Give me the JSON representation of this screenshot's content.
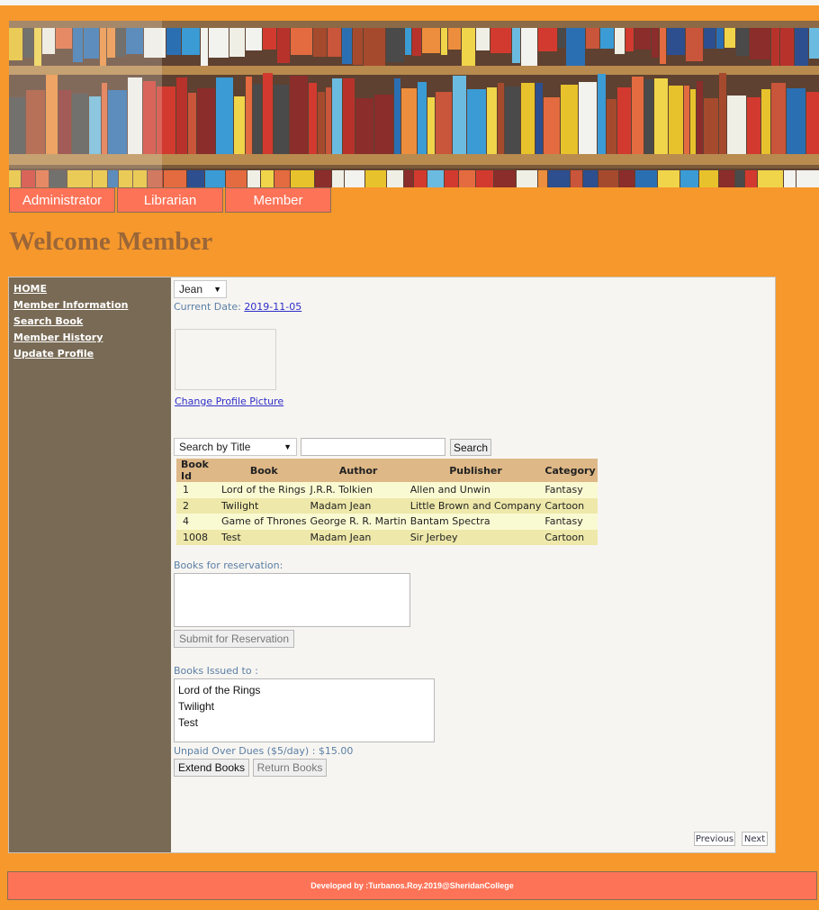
{
  "nav_tabs": [
    "Administrator",
    "Librarian",
    "Member"
  ],
  "welcome_title": "Welcome Member",
  "sidebar": {
    "items": [
      {
        "label": "HOME"
      },
      {
        "label": "Member Information"
      },
      {
        "label": "Search Book",
        "active": true
      },
      {
        "label": "Member History"
      },
      {
        "label": "Update Profile"
      }
    ]
  },
  "member_select": {
    "value": "Jean"
  },
  "current_date": {
    "label": "Current Date:",
    "value": "2019-11-05"
  },
  "profile": {
    "change_picture_label": "Change Profile Picture"
  },
  "search": {
    "mode_value": "Search by Title",
    "query": "",
    "button_label": "Search"
  },
  "books_table": {
    "headers": [
      "Book Id",
      "Book",
      "Author",
      "Publisher",
      "Category"
    ],
    "rows": [
      [
        "1",
        "Lord of the Rings",
        "J.R.R. Tolkien",
        "Allen and Unwin",
        "Fantasy"
      ],
      [
        "2",
        "Twilight",
        "Madam Jean",
        "Little Brown and Company",
        "Cartoon"
      ],
      [
        "4",
        "Game of Thrones",
        "George R. R. Martin",
        "Bantam Spectra",
        "Fantasy"
      ],
      [
        "1008",
        "Test",
        "Madam Jean",
        "Sir Jerbey",
        "Cartoon"
      ]
    ]
  },
  "reservation": {
    "label": "Books for reservation:",
    "items": [],
    "submit_label": "Submit for Reservation"
  },
  "issued": {
    "label": "Books Issued to :",
    "items": [
      "Lord of the Rings",
      "Twilight",
      "Test"
    ]
  },
  "dues": {
    "label": "Unpaid Over Dues ($5/day) :",
    "amount": "$15.00"
  },
  "actions": {
    "extend_label": "Extend Books",
    "return_label": "Return Books"
  },
  "pager": {
    "previous_label": "Previous",
    "next_label": "Next"
  },
  "footer": {
    "text": "Developed by :Turbanos.Roy.2019@SheridanCollege"
  },
  "colors": {
    "page_bg": "#f6982c",
    "tab_bg": "#fd7357",
    "sidebar_bg": "#786a55",
    "welcome_text": "#9b6638",
    "table_header": "#deb887",
    "row_odd": "#fafad2",
    "row_even": "#eee8aa"
  },
  "banner_image": "library-bookshelf-banner"
}
